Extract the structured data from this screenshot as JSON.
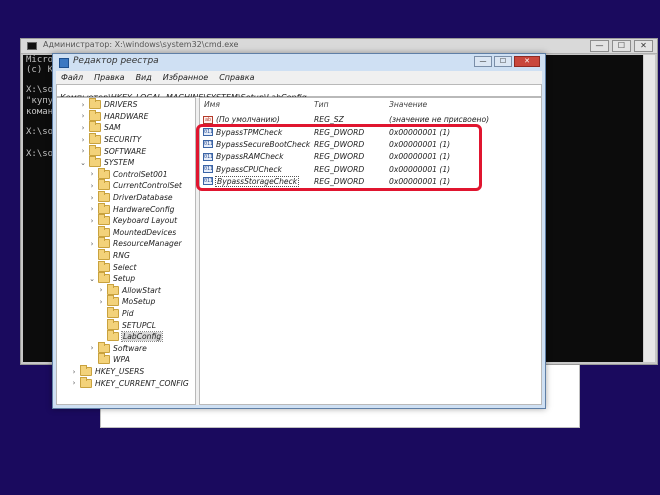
{
  "cmd": {
    "title": "Администратор: X:\\windows\\system32\\cmd.exe",
    "buttons": [
      "—",
      "☐",
      "✕"
    ],
    "lines": [
      "Micro",
      "(c) K",
      "",
      "X:\\so",
      "\"купу",
      "коман",
      "",
      "X:\\so",
      "",
      "X:\\so"
    ]
  },
  "regedit": {
    "title": "Редактор реестра",
    "buttons": [
      "—",
      "☐",
      "✕"
    ],
    "menu": [
      "Файл",
      "Правка",
      "Вид",
      "Избранное",
      "Справка"
    ],
    "address": "Компьютер\\HKEY_LOCAL_MACHINE\\SYSTEM\\Setup\\LabConfig",
    "tree": [
      {
        "label": "DRIVERS",
        "expander": "›"
      },
      {
        "label": "HARDWARE",
        "expander": "›"
      },
      {
        "label": "SAM",
        "expander": "›"
      },
      {
        "label": "SECURITY",
        "expander": "›"
      },
      {
        "label": "SOFTWARE",
        "expander": "›"
      },
      {
        "label": "SYSTEM",
        "expander": "⌄"
      },
      {
        "label": "ControlSet001",
        "expander": "›"
      },
      {
        "label": "CurrentControlSet",
        "expander": "›"
      },
      {
        "label": "DriverDatabase",
        "expander": "›"
      },
      {
        "label": "HardwareConfig",
        "expander": "›"
      },
      {
        "label": "Keyboard Layout",
        "expander": "›"
      },
      {
        "label": "MountedDevices",
        "expander": ""
      },
      {
        "label": "ResourceManager",
        "expander": "›"
      },
      {
        "label": "RNG",
        "expander": ""
      },
      {
        "label": "Select",
        "expander": ""
      },
      {
        "label": "Setup",
        "expander": "⌄"
      },
      {
        "label": "AllowStart",
        "expander": "›"
      },
      {
        "label": "MoSetup",
        "expander": "›"
      },
      {
        "label": "Pid",
        "expander": ""
      },
      {
        "label": "SETUPCL",
        "expander": ""
      },
      {
        "label": "LabConfig",
        "expander": ""
      },
      {
        "label": "Software",
        "expander": "›"
      },
      {
        "label": "WPA",
        "expander": ""
      },
      {
        "label": "HKEY_USERS",
        "expander": "›"
      },
      {
        "label": "HKEY_CURRENT_CONFIG",
        "expander": "›"
      }
    ],
    "columns": {
      "name": "Имя",
      "type": "Тип",
      "data": "Значение"
    },
    "values": [
      {
        "icon": "ab",
        "name": "(По умолчанию)",
        "type": "REG_SZ",
        "data": "(значение не присвоено)"
      },
      {
        "icon": "011",
        "name": "BypassTPMCheck",
        "type": "REG_DWORD",
        "data": "0x00000001 (1)"
      },
      {
        "icon": "011",
        "name": "BypassSecureBootCheck",
        "type": "REG_DWORD",
        "data": "0x00000001 (1)"
      },
      {
        "icon": "011",
        "name": "BypassRAMCheck",
        "type": "REG_DWORD",
        "data": "0x00000001 (1)"
      },
      {
        "icon": "011",
        "name": "BypassCPUCheck",
        "type": "REG_DWORD",
        "data": "0x00000001 (1)"
      },
      {
        "icon": "011",
        "name": "BypassStorageCheck",
        "type": "REG_DWORD",
        "data": "0x00000001 (1)"
      }
    ]
  },
  "colors": {
    "desktop": "#1a0a5e",
    "highlight": "#e0152f",
    "folder": "#f3d27a"
  }
}
